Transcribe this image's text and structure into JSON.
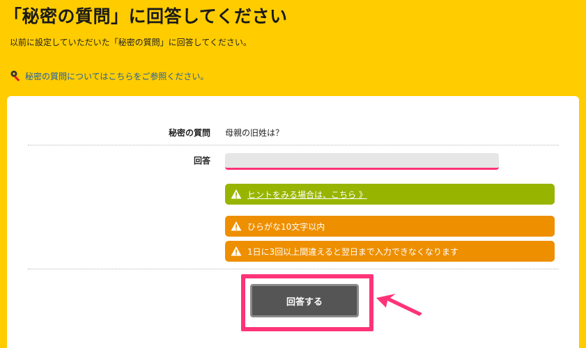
{
  "page": {
    "title": "「秘密の質問」に回答してください",
    "subtitle": "以前に設定していただいた「秘密の質問」に回答してください。",
    "help_link": "秘密の質問についてはこちらをご参照ください。"
  },
  "form": {
    "question_label": "秘密の質問",
    "question_value": "母親の旧姓は？",
    "answer_label": "回答",
    "answer_value": "",
    "answer_placeholder": ""
  },
  "notices": {
    "hint_link": "ヒントをみる場合は、こちら 》",
    "hiragana_rule": "ひらがな10文字以内",
    "attempt_limit": "1日に3回以上間違えると翌日まで入力できなくなります"
  },
  "actions": {
    "submit_label": "回答する"
  },
  "colors": {
    "background": "#ffcc00",
    "hint_green": "#97b500",
    "warning_orange": "#ee8f00",
    "highlight_pink": "#ff3377",
    "button_gray": "#555555"
  }
}
